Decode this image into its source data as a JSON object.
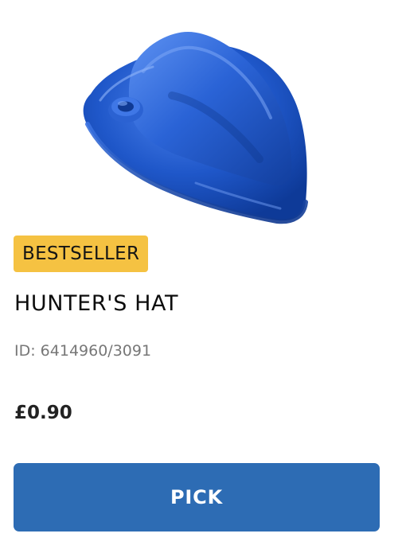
{
  "product": {
    "badge": "BESTSELLER",
    "name": "HUNTER'S HAT",
    "id_text": "ID: 6414960/3091",
    "price": "£0.90",
    "pick_label": "PICK",
    "image_color": "#1f57c9",
    "badge_color": "#f5c242",
    "button_color": "#2d6cb4"
  }
}
